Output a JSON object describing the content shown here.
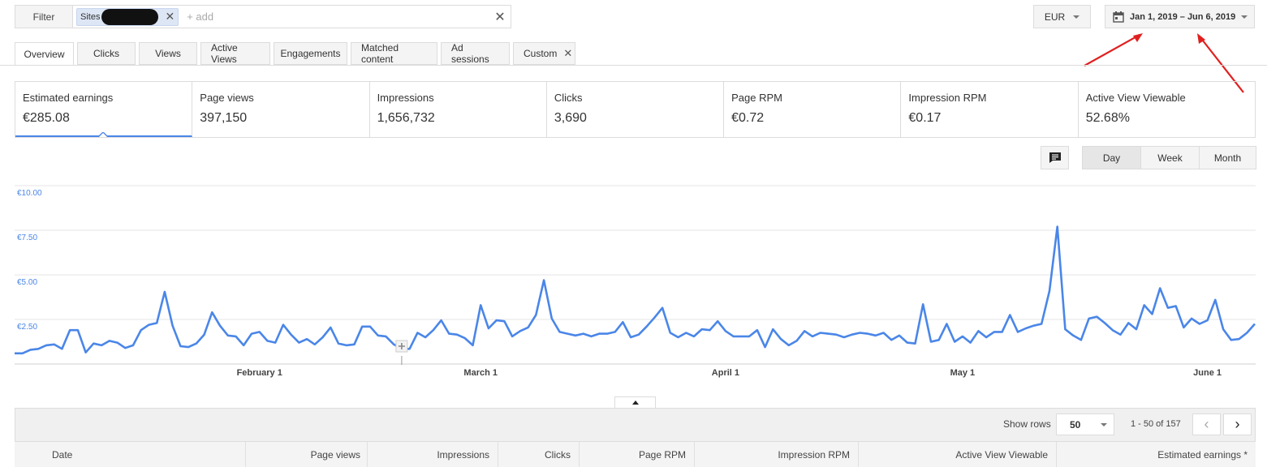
{
  "filter": {
    "button_label": "Filter",
    "chip_label": "Sites",
    "add_placeholder": "+ add"
  },
  "currency": {
    "value": "EUR"
  },
  "date_range": {
    "value": "Jan 1, 2019 – Jun 6, 2019"
  },
  "tabs": [
    {
      "label": "Overview",
      "active": true
    },
    {
      "label": "Clicks"
    },
    {
      "label": "Views"
    },
    {
      "label": "Active Views"
    },
    {
      "label": "Engagements"
    },
    {
      "label": "Matched content"
    },
    {
      "label": "Ad sessions"
    },
    {
      "label": "Custom"
    }
  ],
  "metrics": [
    {
      "label": "Estimated earnings",
      "value": "€285.08"
    },
    {
      "label": "Page views",
      "value": "397,150"
    },
    {
      "label": "Impressions",
      "value": "1,656,732"
    },
    {
      "label": "Clicks",
      "value": "3,690"
    },
    {
      "label": "Page RPM",
      "value": "€0.72"
    },
    {
      "label": "Impression RPM",
      "value": "€0.17"
    },
    {
      "label": "Active View Viewable",
      "value": "52.68%"
    }
  ],
  "granularity": {
    "day": "Day",
    "week": "Week",
    "month": "Month",
    "selected": "Day"
  },
  "chart_data": {
    "type": "line",
    "series": [
      {
        "name": "Estimated earnings",
        "color": "#4a86e8",
        "values": [
          0.6,
          0.6,
          0.8,
          0.85,
          1.05,
          1.1,
          0.85,
          1.9,
          1.9,
          0.65,
          1.15,
          1.05,
          1.3,
          1.2,
          0.9,
          1.05,
          1.9,
          2.2,
          2.3,
          4.05,
          2.15,
          1.0,
          0.95,
          1.15,
          1.65,
          2.9,
          2.15,
          1.6,
          1.55,
          1.05,
          1.7,
          1.8,
          1.3,
          1.2,
          2.2,
          1.65,
          1.2,
          1.4,
          1.1,
          1.5,
          2.05,
          1.15,
          1.05,
          1.1,
          2.1,
          2.1,
          1.6,
          1.55,
          1.1,
          0.85,
          0.85,
          1.75,
          1.5,
          1.9,
          2.45,
          1.7,
          1.65,
          1.45,
          1.05,
          3.3,
          2.0,
          2.45,
          2.4,
          1.55,
          1.85,
          2.05,
          2.75,
          4.7,
          2.55,
          1.8,
          1.7,
          1.6,
          1.7,
          1.55,
          1.7,
          1.7,
          1.8,
          2.35,
          1.5,
          1.65,
          2.1,
          2.6,
          3.15,
          1.75,
          1.5,
          1.75,
          1.55,
          1.95,
          1.9,
          2.4,
          1.85,
          1.55,
          1.55,
          1.55,
          1.9,
          0.95,
          1.95,
          1.4,
          1.05,
          1.3,
          1.85,
          1.55,
          1.75,
          1.7,
          1.65,
          1.5,
          1.65,
          1.75,
          1.7,
          1.6,
          1.75,
          1.35,
          1.6,
          1.2,
          1.15,
          3.35,
          1.25,
          1.35,
          2.25,
          1.25,
          1.55,
          1.2,
          1.85,
          1.5,
          1.8,
          1.8,
          2.75,
          1.8,
          2.0,
          2.15,
          2.25,
          4.1,
          7.7,
          1.95,
          1.6,
          1.35,
          2.55,
          2.65,
          2.3,
          1.9,
          1.65,
          2.3,
          1.95,
          3.3,
          2.8,
          4.25,
          3.15,
          3.25,
          2.05,
          2.55,
          2.25,
          2.45,
          3.6,
          1.95,
          1.35,
          1.4,
          1.75,
          2.25
        ]
      }
    ],
    "ylim": [
      0,
      10
    ],
    "yticks": [
      2.5,
      5.0,
      7.5,
      10.0
    ],
    "ytick_labels": [
      "€2.50",
      "€5.00",
      "€7.50",
      "€10.00"
    ],
    "xtick_labels": [
      {
        "label": "February 1",
        "index": 31
      },
      {
        "label": "March 1",
        "index": 59
      },
      {
        "label": "April 1",
        "index": 90
      },
      {
        "label": "May 1",
        "index": 120
      },
      {
        "label": "June 1",
        "index": 151
      }
    ],
    "grid": true,
    "annotation_marker_index": 49
  },
  "table": {
    "show_rows_label": "Show rows",
    "rows_value": "50",
    "range_label": "1 - 50 of 157",
    "columns": [
      "Date",
      "Page views",
      "Impressions",
      "Clicks",
      "Page RPM",
      "Impression RPM",
      "Active View Viewable",
      "Estimated earnings *"
    ]
  }
}
